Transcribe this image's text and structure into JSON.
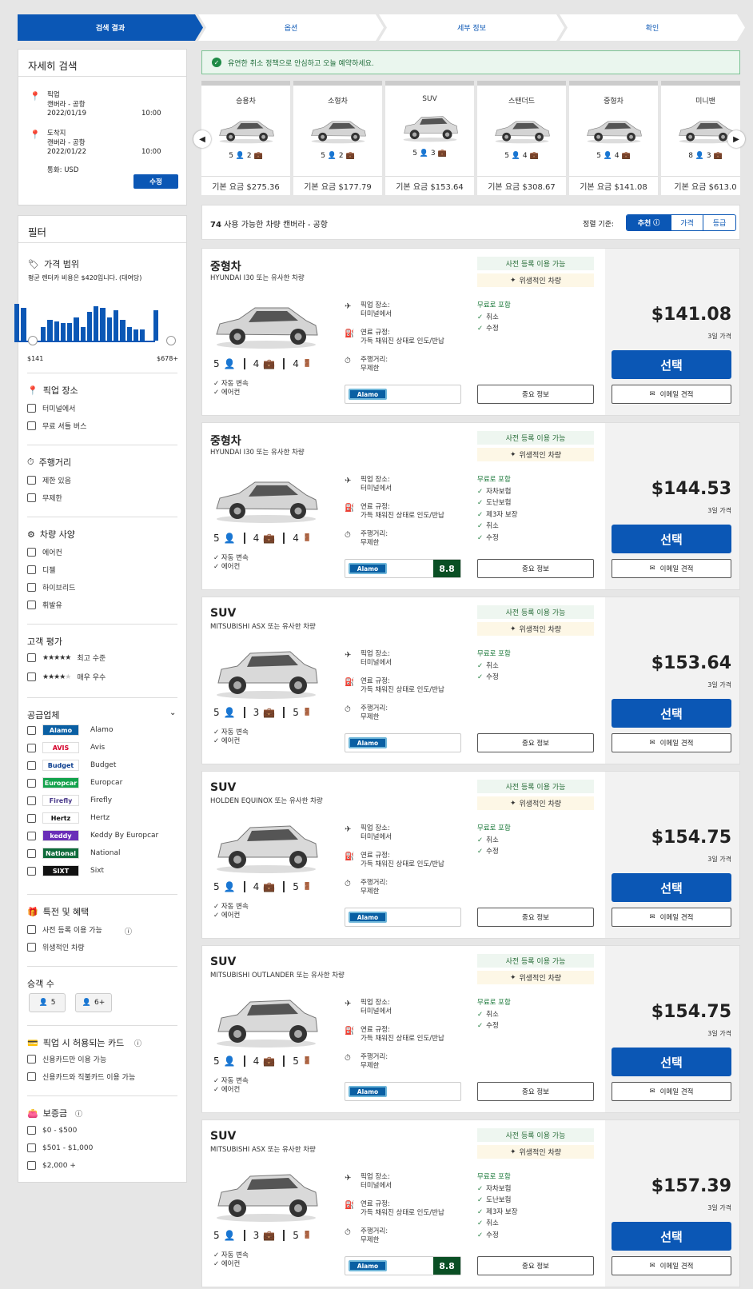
{
  "steps": [
    "검색 결과",
    "옵션",
    "세부 정보",
    "확인"
  ],
  "search": {
    "title": "자세히 검색",
    "pickup_label": "픽업",
    "pickup_loc": "캔버라 - 공항",
    "pickup_date": "2022/01/19",
    "pickup_time": "10:00",
    "dropoff_label": "도착지",
    "dropoff_loc": "캔버라 - 공항",
    "dropoff_date": "2022/01/22",
    "dropoff_time": "10:00",
    "currency": "통화: USD",
    "edit_label": "수정"
  },
  "filter": {
    "title": "필터",
    "price_title": "가격 범위",
    "price_note": "평균 렌터카 비용은 $420입니다. (대여당)",
    "hist_values": [
      0.95,
      0.85,
      0,
      0,
      0.35,
      0.55,
      0.5,
      0.45,
      0.45,
      0.6,
      0.35,
      0.75,
      0.9,
      0.85,
      0.6,
      0.8,
      0.55,
      0.35,
      0.3,
      0.3,
      0,
      0.8
    ],
    "price_min": "$141",
    "price_max": "$678+",
    "pickup_title": "픽업 장소",
    "pickup_opts": [
      "터미널에서",
      "무료 셔틀 버스"
    ],
    "mileage_title": "주행거리",
    "mileage_opts": [
      "제한 있음",
      "무제한"
    ],
    "specs_title": "차량 사양",
    "specs_opts": [
      "에어컨",
      "디젤",
      "하이브리드",
      "휘발유"
    ],
    "rating_title": "고객 평가",
    "rating_opts": [
      "최고 수준",
      "매우 우수"
    ],
    "vendor_title": "공급업체",
    "vendors": [
      {
        "logo": "Alamo",
        "name": "Alamo",
        "bg": "#0a5fa3",
        "fg": "#ffffff"
      },
      {
        "logo": "AVIS",
        "name": "Avis",
        "bg": "#ffffff",
        "fg": "#d4002a"
      },
      {
        "logo": "Budget",
        "name": "Budget",
        "bg": "#ffffff",
        "fg": "#0a3d8f"
      },
      {
        "logo": "Europcar",
        "name": "Europcar",
        "bg": "#12a24b",
        "fg": "#ffffff"
      },
      {
        "logo": "Firefly",
        "name": "Firefly",
        "bg": "#ffffff",
        "fg": "#4a3a8a"
      },
      {
        "logo": "Hertz",
        "name": "Hertz",
        "bg": "#ffffff",
        "fg": "#111111"
      },
      {
        "logo": "keddy",
        "name": "Keddy By Europcar",
        "bg": "#6a2eb8",
        "fg": "#ffffff"
      },
      {
        "logo": "National",
        "name": "National",
        "bg": "#0f6b3a",
        "fg": "#ffffff"
      },
      {
        "logo": "SIXT",
        "name": "Sixt",
        "bg": "#111111",
        "fg": "#ffffff"
      }
    ],
    "perks_title": "특전 및 혜택",
    "perks_opts": [
      "사전 등록 이용 가능",
      "위생적인 차량"
    ],
    "pax_title": "승객 수",
    "pax_opts": [
      "5",
      "6+"
    ],
    "card_title": "픽업 시 허용되는 카드",
    "card_opts": [
      "신용카드만 이용 가능",
      "신용카드와 직불카드 이용 가능"
    ],
    "deposit_title": "보증금",
    "deposit_opts": [
      "$0 - $500",
      "$501 - $1,000",
      "$2,000 +"
    ]
  },
  "banner": "유연한 취소 정책으로 안심하고 오늘 예약하세요.",
  "categories": [
    {
      "name": "승용차",
      "specs": "5 👤 2 💼",
      "price": "기본 요금 $275.36"
    },
    {
      "name": "소형차",
      "specs": "5 👤 2 💼",
      "price": "기본 요금 $177.79"
    },
    {
      "name": "SUV",
      "specs": "5 👤 3 💼",
      "price": "기본 요금 $153.64"
    },
    {
      "name": "스탠더드",
      "specs": "5 👤 4 💼",
      "price": "기본 요금 $308.67"
    },
    {
      "name": "중형차",
      "specs": "5 👤 4 💼",
      "price": "기본 요금 $141.08"
    },
    {
      "name": "미니밴",
      "specs": "8 👤 3 💼",
      "price": "기본 요금 $613.0"
    }
  ],
  "sort": {
    "count": "74",
    "count_text": "사용 가능한 차량 캔버라 - 공항",
    "label": "정렬 기준:",
    "options": [
      "추천",
      "가격",
      "등급"
    ]
  },
  "cars": [
    {
      "class": "중형차",
      "model": "HYUNDAI I30 또는 유사한 차량",
      "pax": "5",
      "bags": "4",
      "doors": "4",
      "pickup": "터미널에서",
      "fuel": "가득 채워진 상태로 인도/반납",
      "mileage": "무제한",
      "included": [
        "취소",
        "수정"
      ],
      "price": "$141.08",
      "score": ""
    },
    {
      "class": "중형차",
      "model": "HYUNDAI I30 또는 유사한 차량",
      "pax": "5",
      "bags": "4",
      "doors": "4",
      "pickup": "터미널에서",
      "fuel": "가득 채워진 상태로 인도/반납",
      "mileage": "무제한",
      "included": [
        "자차보험",
        "도난보험",
        "제3자 보장",
        "취소",
        "수정"
      ],
      "price": "$144.53",
      "score": "8.8"
    },
    {
      "class": "SUV",
      "model": "MITSUBISHI ASX 또는 유사한 차량",
      "pax": "5",
      "bags": "3",
      "doors": "5",
      "pickup": "터미널에서",
      "fuel": "가득 채워진 상태로 인도/반납",
      "mileage": "무제한",
      "included": [
        "취소",
        "수정"
      ],
      "price": "$153.64",
      "score": ""
    },
    {
      "class": "SUV",
      "model": "HOLDEN EQUINOX 또는 유사한 차량",
      "pax": "5",
      "bags": "4",
      "doors": "5",
      "pickup": "터미널에서",
      "fuel": "가득 채워진 상태로 인도/반납",
      "mileage": "무제한",
      "included": [
        "취소",
        "수정"
      ],
      "price": "$154.75",
      "score": ""
    },
    {
      "class": "SUV",
      "model": "MITSUBISHI OUTLANDER 또는 유사한 차량",
      "pax": "5",
      "bags": "4",
      "doors": "5",
      "pickup": "터미널에서",
      "fuel": "가득 채워진 상태로 인도/반납",
      "mileage": "무제한",
      "included": [
        "취소",
        "수정"
      ],
      "price": "$154.75",
      "score": ""
    },
    {
      "class": "SUV",
      "model": "MITSUBISHI ASX 또는 유사한 차량",
      "pax": "5",
      "bags": "3",
      "doors": "5",
      "pickup": "터미널에서",
      "fuel": "가득 채워진 상태로 인도/반납",
      "mileage": "무제한",
      "included": [
        "자차보험",
        "도난보험",
        "제3자 보장",
        "취소",
        "수정"
      ],
      "price": "$157.39",
      "score": "8.8"
    }
  ],
  "card_labels": {
    "prereg": "사전 등록 이용 가능",
    "hygiene": "위생적인 차량",
    "pickup": "픽업 장소:",
    "fuel": "연료 규정:",
    "mileage": "주행거리:",
    "included": "무료로 포함",
    "features": [
      "자동 변속",
      "에어컨"
    ],
    "vendor": "Alamo",
    "info": "중요 정보",
    "days": "3일 가격",
    "select": "선택",
    "email": "이메일 견적"
  }
}
